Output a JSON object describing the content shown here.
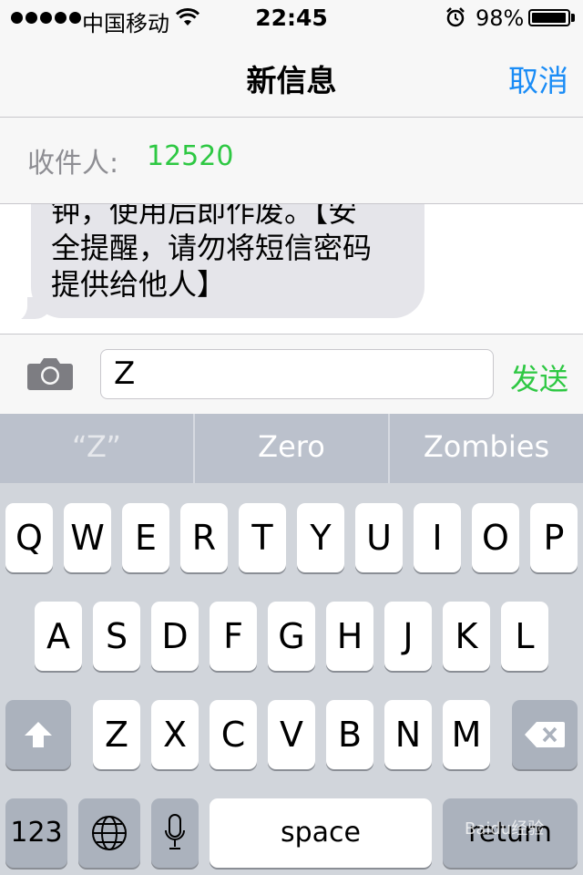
{
  "status_bar": {
    "carrier": "中国移动",
    "time": "22:45",
    "battery": "98%",
    "battery_level": 0.98
  },
  "nav": {
    "title": "新信息",
    "cancel": "取消"
  },
  "recipient": {
    "label": "收件人:",
    "value": "12520"
  },
  "message": {
    "text": "钟，使用后即作废。【安\n全提醒，请勿将短信密码\n提供给他人】"
  },
  "composer": {
    "input_value": "Z",
    "send": "发送"
  },
  "suggestions": [
    "“Z”",
    "Zero",
    "Zombies"
  ],
  "keyboard": {
    "row1": [
      "Q",
      "W",
      "E",
      "R",
      "T",
      "Y",
      "U",
      "I",
      "O",
      "P"
    ],
    "row2": [
      "A",
      "S",
      "D",
      "F",
      "G",
      "H",
      "J",
      "K",
      "L"
    ],
    "row3": [
      "Z",
      "X",
      "C",
      "V",
      "B",
      "N",
      "M"
    ],
    "numbers": "123",
    "space": "space",
    "return": "return"
  },
  "watermark": "Baidu经验",
  "colors": {
    "accent_blue": "#1a8cf6",
    "accent_green": "#2ec843",
    "bubble": "#e5e5ea",
    "keyboard_bg": "#d1d5db"
  }
}
